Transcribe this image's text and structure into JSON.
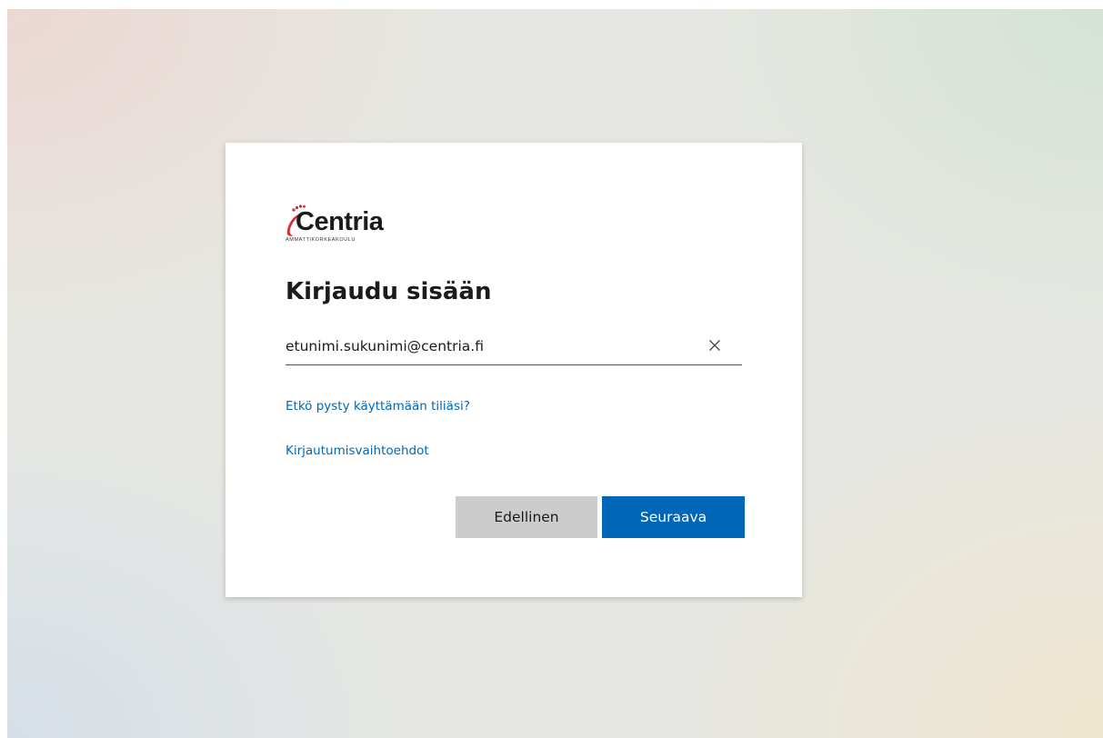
{
  "logo": {
    "name": "Centria",
    "tagline": "AMMATTIKORKEAKOULU",
    "brand_color": "#d7282f"
  },
  "signin": {
    "title": "Kirjaudu sisään",
    "email_value": "etunimi.sukunimi@centria.fi",
    "clear_icon": "close-icon",
    "cant_access_link": "Etkö pysty käyttämään tiliäsi?",
    "signin_options_link": "Kirjautumisvaihtoehdot",
    "back_button": "Edellinen",
    "next_button": "Seuraava"
  },
  "colors": {
    "accent": "#0067b8",
    "secondary_button": "#cccccc",
    "text": "#1b1b1b"
  }
}
